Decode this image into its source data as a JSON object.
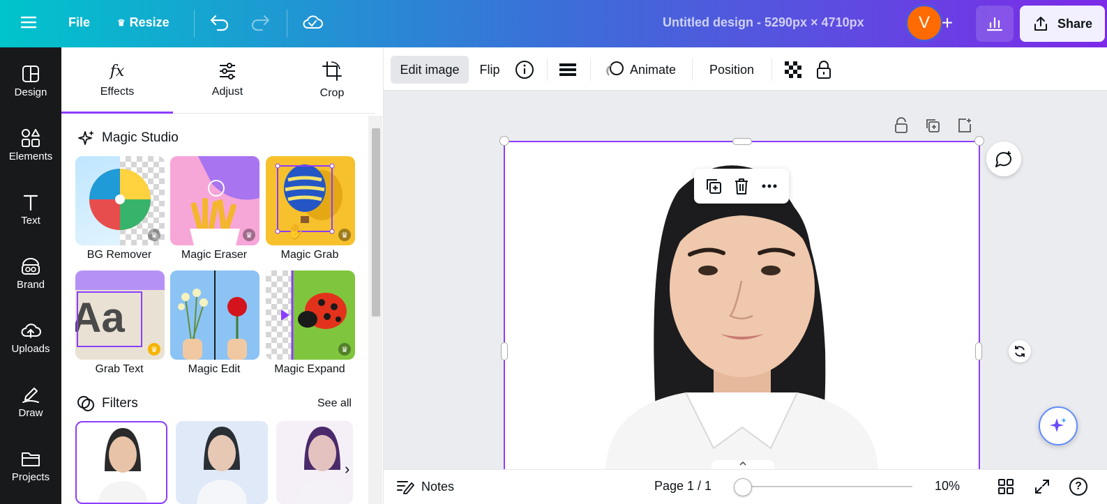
{
  "topbar": {
    "file_label": "File",
    "resize_label": "Resize",
    "doc_title": "Untitled design - 5290px × 4710px",
    "avatar_letter": "V",
    "plus_label": "+",
    "share_label": "Share"
  },
  "rail": {
    "items": [
      {
        "label": "Design",
        "icon": "layout-icon"
      },
      {
        "label": "Elements",
        "icon": "shapes-icon"
      },
      {
        "label": "Text",
        "icon": "text-icon"
      },
      {
        "label": "Brand",
        "icon": "brand-icon"
      },
      {
        "label": "Uploads",
        "icon": "cloud-upload-icon"
      },
      {
        "label": "Draw",
        "icon": "pen-icon"
      },
      {
        "label": "Projects",
        "icon": "folder-icon"
      }
    ]
  },
  "panel": {
    "tabs": [
      {
        "label": "Effects",
        "active": true
      },
      {
        "label": "Adjust",
        "active": false
      },
      {
        "label": "Crop",
        "active": false
      }
    ],
    "magic_studio_title": "Magic Studio",
    "magic_tools": [
      {
        "label": "BG Remover"
      },
      {
        "label": "Magic Eraser"
      },
      {
        "label": "Magic Grab"
      },
      {
        "label": "Grab Text"
      },
      {
        "label": "Magic Edit"
      },
      {
        "label": "Magic Expand"
      }
    ],
    "grab_text_sample": "Aa",
    "filters_title": "Filters",
    "see_all_label": "See all",
    "next_label": "›"
  },
  "toolbar": {
    "edit_image_label": "Edit image",
    "flip_label": "Flip",
    "animate_label": "Animate",
    "position_label": "Position"
  },
  "bottombar": {
    "notes_label": "Notes",
    "page_label": "Page 1 / 1",
    "zoom_label": "10%",
    "zoom_fraction": 0.0,
    "help_label": "?"
  },
  "colors": {
    "accent": "#8b3dff",
    "topbar_start": "#00c4cc",
    "topbar_end": "#7d2ae8",
    "avatar": "#ff6b00",
    "rail_bg": "#18191b"
  }
}
